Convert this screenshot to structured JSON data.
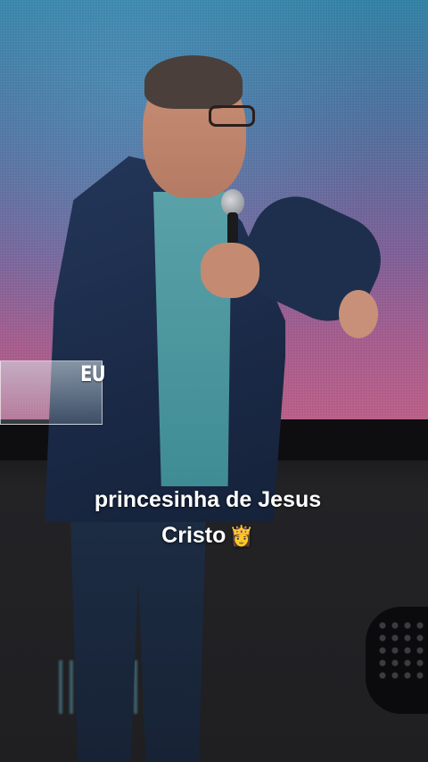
{
  "overlay": {
    "tag": "EU"
  },
  "caption": {
    "line1": "princesinha de Jesus",
    "line2": "Cristo",
    "emoji": "👸"
  }
}
